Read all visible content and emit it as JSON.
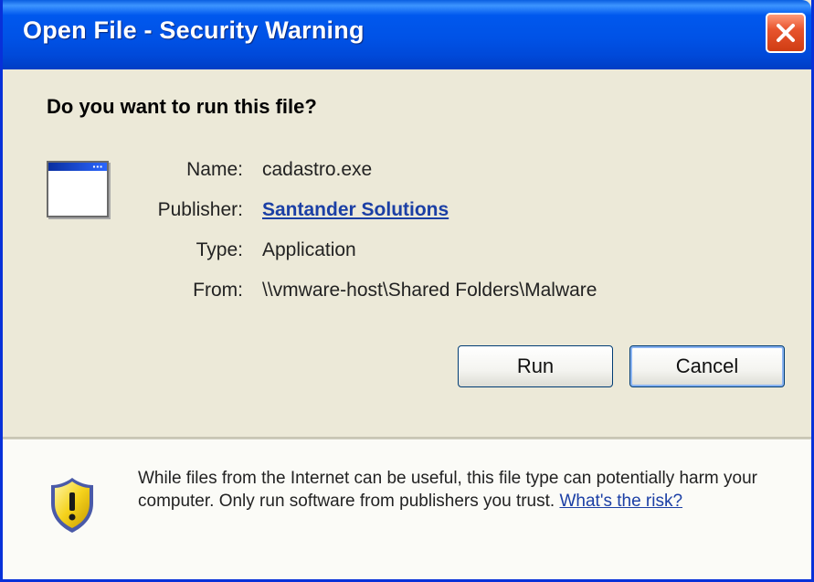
{
  "window": {
    "title": "Open File - Security Warning",
    "title_bar_color": "#0058ee",
    "close_color": "#e8552e"
  },
  "dialog": {
    "question": "Do you want to run this file?",
    "file_icon": "application-window-icon",
    "fields": [
      {
        "label": "Name:",
        "value": "cadastro.exe"
      },
      {
        "label": "Publisher:",
        "value": "Santander Solutions"
      },
      {
        "label": "Type:",
        "value": "Application"
      },
      {
        "label": "From:",
        "value": "\\\\vmware-host\\Shared Folders\\Malware"
      }
    ],
    "run_label": "Run",
    "cancel_label": "Cancel"
  },
  "warning": {
    "icon": "shield-warning-icon",
    "text": "While files from the Internet can be useful, this file type can potentially harm your computer. Only run software from publishers you trust.",
    "link_label": "What's the risk?",
    "link_color": "#1b3fa5"
  }
}
